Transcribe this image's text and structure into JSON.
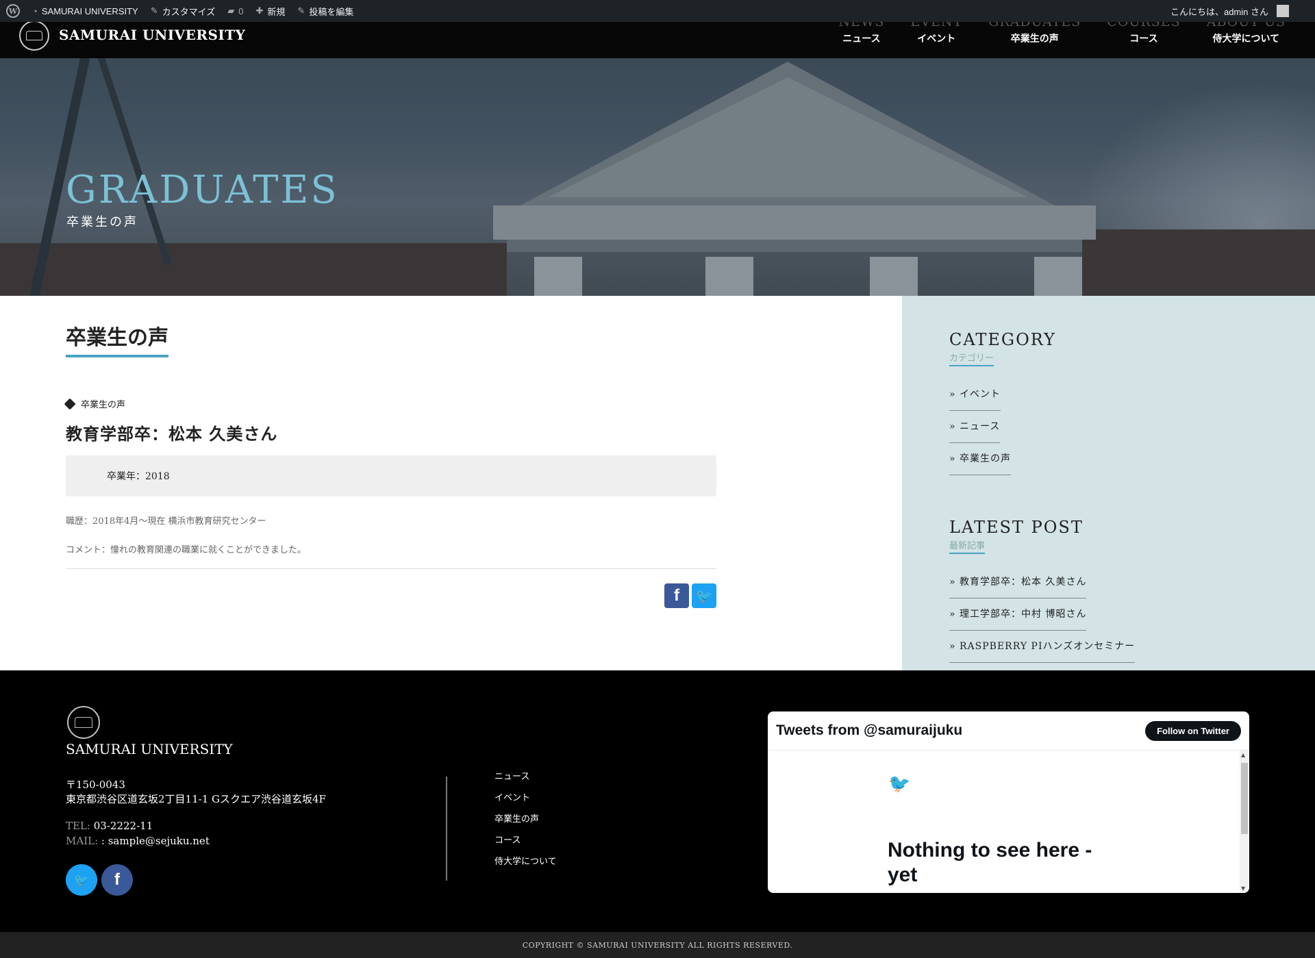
{
  "adminbar": {
    "site_name": "SAMURAI UNIVERSITY",
    "customize": "カスタマイズ",
    "comments_count": "0",
    "new": "新規",
    "edit_post": "投稿を編集",
    "greeting": "こんにちは、admin さん"
  },
  "header": {
    "site_name": "SAMURAI UNIVERSITY",
    "nav": [
      {
        "en": "NEWS",
        "ja": "ニュース"
      },
      {
        "en": "EVENT",
        "ja": "イベント"
      },
      {
        "en": "GRADUATES",
        "ja": "卒業生の声"
      },
      {
        "en": "COURSES",
        "ja": "コース"
      },
      {
        "en": "ABOUT US",
        "ja": "侍大学について"
      }
    ]
  },
  "hero": {
    "title": "GRADUATES",
    "subtitle": "卒業生の声"
  },
  "main": {
    "page_title": "卒業生の声",
    "category_tag": "卒業生の声",
    "post_title": "教育学部卒：松本 久美さん",
    "graduation_year": "卒業年：2018",
    "career": "職歴：2018年4月～現在 横浜市教育研究センター",
    "comment": "コメント：憧れの教育関連の職業に就くことができました。"
  },
  "sidebar": {
    "category": {
      "heading": "CATEGORY",
      "subheading": "カテゴリー",
      "items": [
        "イベント",
        "ニュース",
        "卒業生の声"
      ]
    },
    "latest": {
      "heading": "LATEST POST",
      "subheading": "最新記事",
      "items": [
        "教育学部卒：松本 久美さん",
        "理工学部卒：中村 博昭さん",
        "RASPBERRY PIハンズオンセミナー"
      ]
    }
  },
  "footer": {
    "site_name": "SAMURAI UNIVERSITY",
    "postal": "〒150-0043",
    "address": "東京都渋谷区道玄坂2丁目11-1 Gスクエア渋谷道玄坂4F",
    "tel_label": "TEL:",
    "tel": " 03-2222-11",
    "mail_label": "MAIL:",
    "mail": " : sample@sejuku.net",
    "nav": [
      "ニュース",
      "イベント",
      "卒業生の声",
      "コース",
      "侍大学について"
    ],
    "twitter": {
      "title": "Tweets from @samuraijuku",
      "follow": "Follow on Twitter",
      "empty": "Nothing to see here - yet"
    },
    "copyright": "COPYRIGHT © SAMURAI UNIVERSITY ALL RIGHTS RESERVED."
  },
  "colors": {
    "accent": "#4aa3c3",
    "hero_title": "#7cc1d6",
    "sidebar_bg": "#d3e3e6",
    "facebook": "#3b5998",
    "twitter": "#1da1f2"
  }
}
